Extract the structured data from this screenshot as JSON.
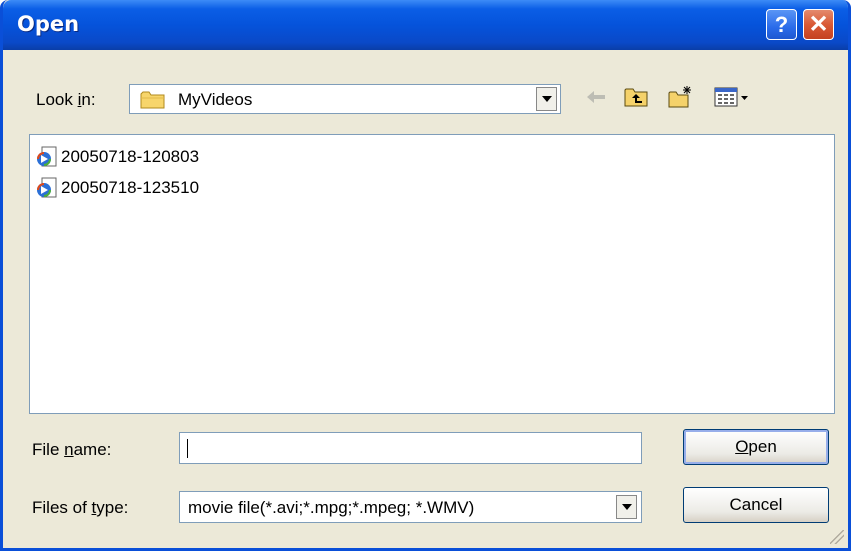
{
  "window": {
    "title": "Open",
    "help_glyph": "?",
    "close_glyph": "✕"
  },
  "toolbar": {
    "look_in_prefix": "Look ",
    "look_in_mnemonic": "i",
    "look_in_suffix": "n:",
    "current_folder": "MyVideos",
    "icons": [
      "back-arrow-icon",
      "up-folder-icon",
      "new-folder-icon",
      "view-menu-icon"
    ]
  },
  "files": [
    {
      "name": "20050718-120803",
      "icon": "media-file-icon"
    },
    {
      "name": "20050718-123510",
      "icon": "media-file-icon"
    }
  ],
  "filename": {
    "label_prefix": "File ",
    "label_mnemonic": "n",
    "label_suffix": "ame:",
    "value": ""
  },
  "filetype": {
    "label_prefix": "Files of ",
    "label_mnemonic": "t",
    "label_suffix": "ype:",
    "value": "movie file(*.avi;*.mpg;*.mpeg; *.WMV)"
  },
  "buttons": {
    "open_mnemonic": "O",
    "open_rest": "pen",
    "cancel": "Cancel"
  },
  "colors": {
    "title_bar": "#0553db",
    "dialog_bg": "#ece9d8",
    "close": "#d95a36"
  }
}
